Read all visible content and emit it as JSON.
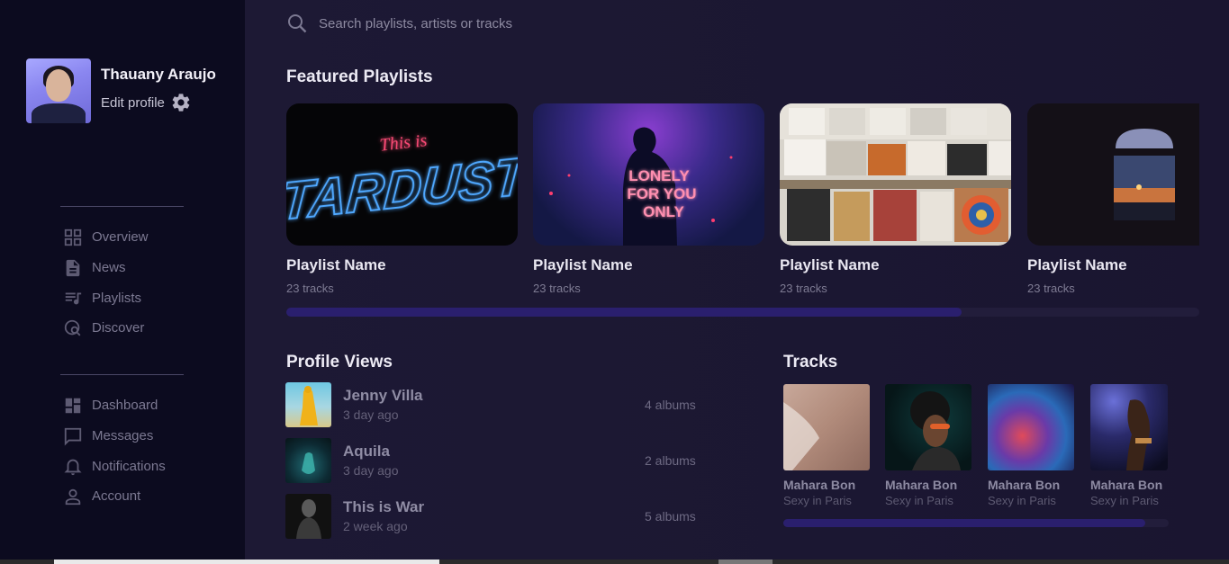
{
  "profile": {
    "name": "Thauany Araujo",
    "edit_label": "Edit profile"
  },
  "nav_primary": [
    {
      "label": "Overview",
      "icon": "grid-icon"
    },
    {
      "label": "News",
      "icon": "document-icon"
    },
    {
      "label": "Playlists",
      "icon": "playlist-icon"
    },
    {
      "label": "Discover",
      "icon": "discover-icon"
    }
  ],
  "nav_secondary": [
    {
      "label": "Dashboard",
      "icon": "dashboard-icon"
    },
    {
      "label": "Messages",
      "icon": "message-icon"
    },
    {
      "label": "Notifications",
      "icon": "bell-icon"
    },
    {
      "label": "Account",
      "icon": "user-icon"
    }
  ],
  "search": {
    "placeholder": "Search playlists, artists or tracks"
  },
  "featured": {
    "title": "Featured Playlists",
    "items": [
      {
        "name": "Playlist Name",
        "count": "23 tracks",
        "cover_text_line1": "This is",
        "cover_text_line2": "STARDUST"
      },
      {
        "name": "Playlist Name",
        "count": "23 tracks",
        "cover_text_line1": "LONELY",
        "cover_text_line2": "FOR YOU",
        "cover_text_line3": "ONLY"
      },
      {
        "name": "Playlist Name",
        "count": "23 tracks"
      },
      {
        "name": "Playlist Name",
        "count": "23 tracks"
      }
    ],
    "scroll_progress": 0.74
  },
  "profile_views": {
    "title": "Profile Views",
    "items": [
      {
        "name": "Jenny Villa",
        "time": "3 day ago",
        "albums": "4 albums"
      },
      {
        "name": "Aquila",
        "time": "3 day ago",
        "albums": "2 albums"
      },
      {
        "name": "This is War",
        "time": "2 week ago",
        "albums": "5 albums"
      }
    ]
  },
  "tracks": {
    "title": "Tracks",
    "items": [
      {
        "title": "Mahara Bon",
        "subtitle": "Sexy in Paris"
      },
      {
        "title": "Mahara Bon",
        "subtitle": "Sexy in Paris"
      },
      {
        "title": "Mahara Bon",
        "subtitle": "Sexy in Paris"
      },
      {
        "title": "Mahara Bon",
        "subtitle": "Sexy in Paris"
      }
    ],
    "scroll_progress": 0.94
  },
  "colors": {
    "sidebar_bg": "#0c0b1f",
    "main_bg": "#1c1734",
    "accent_scroll": "#2a1f6e"
  }
}
